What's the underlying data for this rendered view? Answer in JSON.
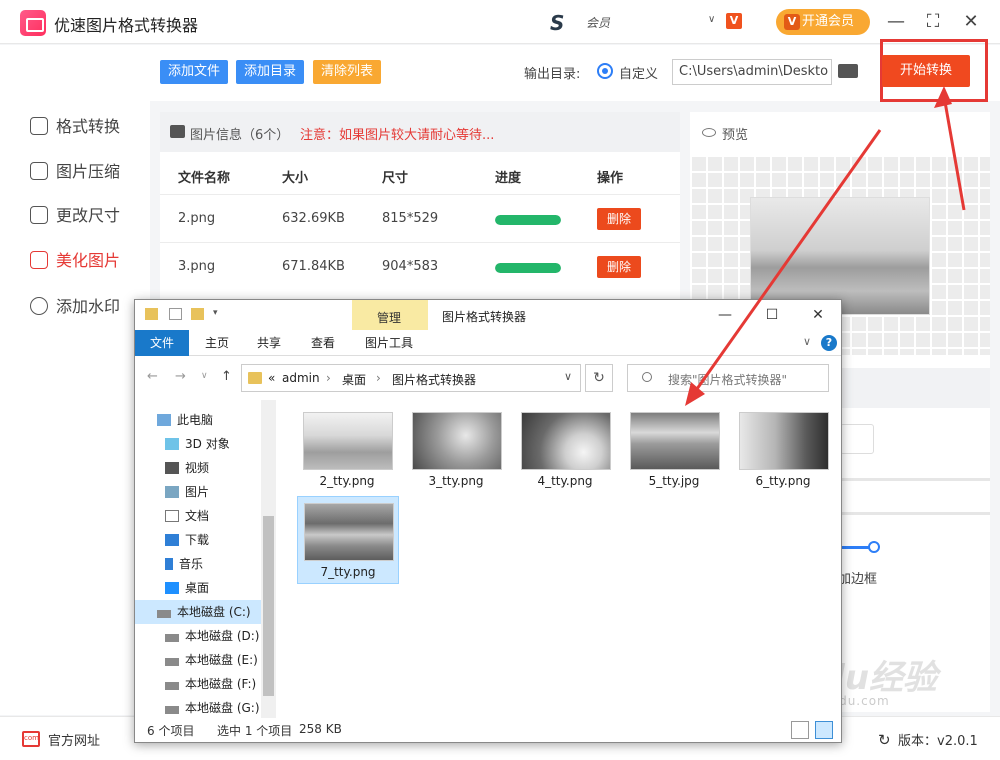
{
  "app": {
    "title": "优速图片格式转换器",
    "member_name": "会员",
    "vip_button": "开通会员"
  },
  "sidebar": {
    "items": [
      {
        "label": "格式转换",
        "active": false
      },
      {
        "label": "图片压缩",
        "active": false
      },
      {
        "label": "更改尺寸",
        "active": false
      },
      {
        "label": "美化图片",
        "active": true
      },
      {
        "label": "添加水印",
        "active": false
      }
    ]
  },
  "toolbar": {
    "add_file": "添加文件",
    "add_dir": "添加目录",
    "clear_list": "清除列表",
    "output_label": "输出目录:",
    "radio_label": "自定义",
    "output_path": "C:\\Users\\admin\\Deskto",
    "start": "开始转换"
  },
  "file_panel": {
    "title": "图片信息（6个）",
    "note": "注意：如果图片较大请耐心等待...",
    "headers": [
      "文件名称",
      "大小",
      "尺寸",
      "进度",
      "操作"
    ],
    "rows": [
      {
        "name": "2.png",
        "size": "632.69KB",
        "dims": "815*529",
        "progress": 1.0,
        "action": "删除"
      },
      {
        "name": "3.png",
        "size": "671.84KB",
        "dims": "904*583",
        "progress": 1.0,
        "action": "删除"
      }
    ]
  },
  "preview": {
    "title": "预览",
    "border_label": "加边框"
  },
  "footer": {
    "site": "官方网址",
    "version": "版本：v2.0.1"
  },
  "watermark": {
    "text": "Baidu经验",
    "url": "jingyan.baidu.com"
  },
  "explorer": {
    "manage": "管理",
    "title": "图片格式转换器",
    "ribbon_tabs": [
      "主页",
      "共享",
      "查看"
    ],
    "file_tab": "文件",
    "picture_tools": "图片工具",
    "breadcrumb": [
      "«",
      "admin",
      "桌面",
      "图片格式转换器"
    ],
    "search_placeholder": "搜索\"图片格式转换器\"",
    "nav_items": [
      {
        "label": "此电脑",
        "icon": "computer-icon"
      },
      {
        "label": "3D 对象",
        "icon": "cube-icon"
      },
      {
        "label": "视频",
        "icon": "video-icon"
      },
      {
        "label": "图片",
        "icon": "picture-icon"
      },
      {
        "label": "文档",
        "icon": "document-icon"
      },
      {
        "label": "下载",
        "icon": "download-icon"
      },
      {
        "label": "音乐",
        "icon": "music-icon"
      },
      {
        "label": "桌面",
        "icon": "desktop-icon"
      },
      {
        "label": "本地磁盘 (C:)",
        "icon": "drive-icon"
      },
      {
        "label": "本地磁盘 (D:)",
        "icon": "drive-icon"
      },
      {
        "label": "本地磁盘 (E:)",
        "icon": "drive-icon"
      },
      {
        "label": "本地磁盘 (F:)",
        "icon": "drive-icon"
      },
      {
        "label": "本地磁盘 (G:)",
        "icon": "drive-icon"
      }
    ],
    "files": [
      {
        "name": "2_tty.png",
        "selected": false
      },
      {
        "name": "3_tty.png",
        "selected": false
      },
      {
        "name": "4_tty.png",
        "selected": false
      },
      {
        "name": "5_tty.jpg",
        "selected": false
      },
      {
        "name": "6_tty.png",
        "selected": false
      },
      {
        "name": "7_tty.png",
        "selected": true
      }
    ],
    "status_count": "6 个项目",
    "status_selected": "选中 1 个项目",
    "status_size": "258 KB"
  },
  "colors": {
    "accent_red": "#f0491f",
    "blue_button": "#3a8ef6",
    "orange_button": "#f9a832",
    "progress_green": "#23b66a"
  }
}
